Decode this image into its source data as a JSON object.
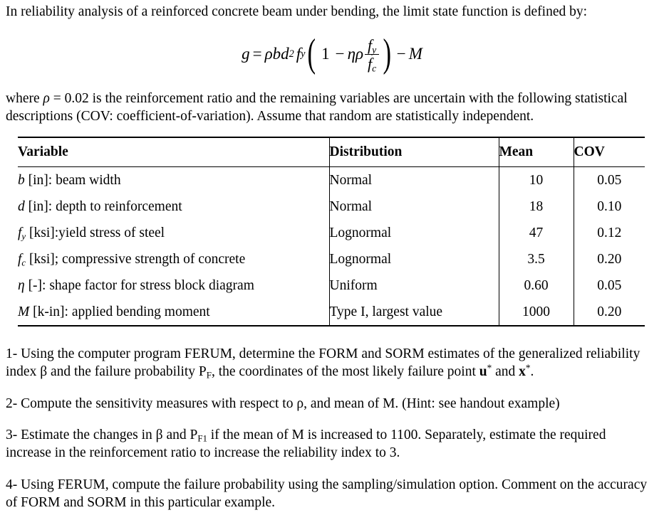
{
  "document": {
    "intro": {
      "prefix": "In reliability analysis of a reinforced concrete beam under bending, the limit state function is defined by:"
    },
    "equation": {
      "latex_like": "g = ρbd² f_y (1 − ηρ f_y/f_c) − M",
      "lhs": "g",
      "equals": "=",
      "rho": "ρ",
      "b": "b",
      "d": "d",
      "d_power": "2",
      "f": "f",
      "f_sub_y": "y",
      "paren_open": "(",
      "one": "1",
      "minus": "−",
      "eta": "η",
      "rho2": "ρ",
      "num_f": "f",
      "num_sub": "y",
      "den_f": "f",
      "den_sub": "c",
      "paren_close": ")",
      "minus2": "−",
      "M": "M"
    },
    "where_paragraph": {
      "part1": "where ",
      "rho": "ρ",
      "part2": " = 0.02 is the reinforcement ratio and the remaining variables are uncertain with the following statistical descriptions (COV: coefficient-of-variation). Assume that random are statistically independent."
    },
    "table": {
      "headers": {
        "variable": "Variable",
        "distribution": "Distribution",
        "mean": "Mean",
        "cov": "COV"
      },
      "rows": [
        {
          "symbol": "b",
          "symbol_sub": "",
          "description": " [in]: beam width",
          "variable_plain": "b [in]: beam width",
          "distribution": "Normal",
          "mean": "10",
          "cov": "0.05"
        },
        {
          "symbol": "d",
          "symbol_sub": "",
          "description": " [in]: depth to reinforcement",
          "variable_plain": "d [in]: depth to reinforcement",
          "distribution": "Normal",
          "mean": "18",
          "cov": "0.10"
        },
        {
          "symbol": "f",
          "symbol_sub": "y",
          "description": " [ksi]:yield stress of steel",
          "variable_plain": "fy [ksi]:yield stress of steel",
          "distribution": "Lognormal",
          "mean": "47",
          "cov": "0.12"
        },
        {
          "symbol": "f",
          "symbol_sub": "c",
          "description": " [ksi]; compressive strength of concrete",
          "variable_plain": "fc [ksi]; compressive strength of concrete",
          "distribution": "Lognormal",
          "mean": "3.5",
          "cov": "0.20"
        },
        {
          "symbol": "η",
          "symbol_sub": "",
          "description": " [-]: shape factor for stress block diagram",
          "variable_plain": "η [-]: shape factor for stress block diagram",
          "distribution": "Uniform",
          "mean": "0.60",
          "cov": "0.05"
        },
        {
          "symbol": "M",
          "symbol_sub": "",
          "description": " [k-in]: applied bending moment",
          "variable_plain": "M [k-in]: applied bending moment",
          "distribution": "Type I, largest value",
          "mean": "1000",
          "cov": "0.20"
        }
      ]
    },
    "questions": [
      {
        "number": "1-",
        "text_a": " Using the computer program FERUM, determine the FORM and SORM estimates of the generalized reliability index ",
        "beta": "β",
        "text_b": " and the failure probability P",
        "pf_sub": "F",
        "text_c": ", the coordinates of the most likely failure point ",
        "u_symbol": "u",
        "u_star": "*",
        "text_d": " and ",
        "x_symbol": "x",
        "x_star": "*",
        "text_e": "."
      },
      {
        "number": "2-",
        "text_a": " Compute the sensitivity measures with respect to ",
        "rho": "ρ",
        "text_b": ", and mean of M. (Hint: see handout example)"
      },
      {
        "number": "3-",
        "text_a": " Estimate the changes in ",
        "beta": "β",
        "text_b": " and P",
        "pf_sub": "F1",
        "text_c": " if the mean of M is increased to 1100. Separately, estimate the required increase in the reinforcement ratio to increase the reliability index to 3."
      },
      {
        "number": "4-",
        "text_a": " Using FERUM, compute the failure probability using the sampling/simulation option. Comment on the accuracy of FORM and SORM in this particular example."
      }
    ]
  },
  "colors": {
    "text": "#000000",
    "background": "#ffffff",
    "rule": "#000000"
  }
}
